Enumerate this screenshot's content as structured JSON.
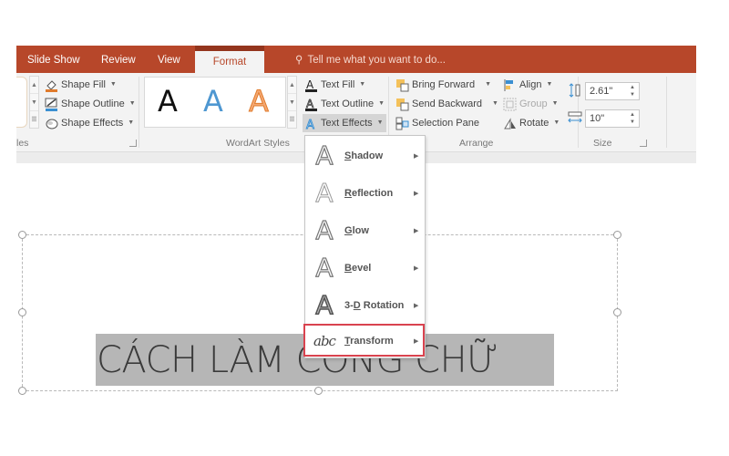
{
  "tabs": [
    {
      "label": "Slide Show",
      "active": false
    },
    {
      "label": "Review",
      "active": false
    },
    {
      "label": "View",
      "active": false
    },
    {
      "label": "Format",
      "active": true
    }
  ],
  "tell_me": {
    "icon": "lightbulb-icon",
    "placeholder": "Tell me what you want to do..."
  },
  "colors": {
    "accent": "#b7472a",
    "highlight_box": "#d9434f",
    "ribbon_bg": "#f3f3f3"
  },
  "ribbon": {
    "shape_styles": {
      "label_fragment": "les",
      "shape_fill": "Shape Fill",
      "shape_outline": "Shape Outline",
      "shape_effects": "Shape Effects"
    },
    "wordart_styles": {
      "label": "WordArt Styles",
      "gallery": [
        {
          "glyph": "A",
          "style": "black"
        },
        {
          "glyph": "A",
          "style": "blue-outline"
        },
        {
          "glyph": "A",
          "style": "orange-outline"
        }
      ],
      "text_fill": "Text Fill",
      "text_outline": "Text Outline",
      "text_effects": "Text Effects"
    },
    "arrange": {
      "label": "Arrange",
      "bring_forward": "Bring Forward",
      "send_backward": "Send Backward",
      "selection_pane": "Selection Pane",
      "align": "Align",
      "group": "Group",
      "rotate": "Rotate"
    },
    "size": {
      "label": "Size",
      "height": "2.61\"",
      "width": "10\""
    }
  },
  "text_effects_menu": {
    "items": [
      {
        "label": "Shadow",
        "accel": "S",
        "rest": "hadow",
        "icon": "shadow-icon"
      },
      {
        "label": "Reflection",
        "accel": "R",
        "rest": "eflection",
        "icon": "reflection-icon"
      },
      {
        "label": "Glow",
        "accel": "G",
        "rest": "low",
        "icon": "glow-icon"
      },
      {
        "label": "Bevel",
        "accel": "B",
        "rest": "evel",
        "icon": "bevel-icon"
      },
      {
        "label": "3-D Rotation",
        "pre": "3-",
        "accel": "D",
        "rest": " Rotation",
        "icon": "3d-rotation-icon"
      },
      {
        "label": "Transform",
        "accel": "T",
        "rest": "ransform",
        "icon": "transform-icon",
        "highlighted": true
      }
    ]
  },
  "slide": {
    "title_text": "CÁCH LÀM CONG CHỮ"
  }
}
